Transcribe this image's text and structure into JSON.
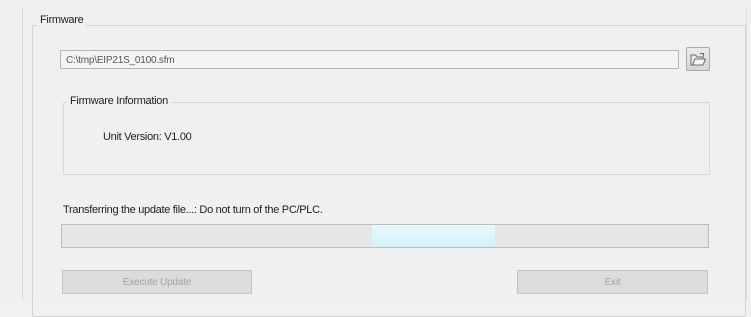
{
  "firmware_group": {
    "title": "Firmware",
    "file_path": "C:\\tmp\\EIP21S_0100.sfm",
    "browse_icon": "open-folder-icon"
  },
  "firmware_info": {
    "title": "Firmware Information",
    "unit_version": "Unit Version: V1.00"
  },
  "status": {
    "text": "Transferring the update file...: Do not turn of the PC/PLC."
  },
  "progress": {
    "chunk_start_fraction": 0.48,
    "chunk_end_fraction": 0.67
  },
  "buttons": {
    "execute_label": "Execute Update",
    "exit_label": "Exit"
  }
}
